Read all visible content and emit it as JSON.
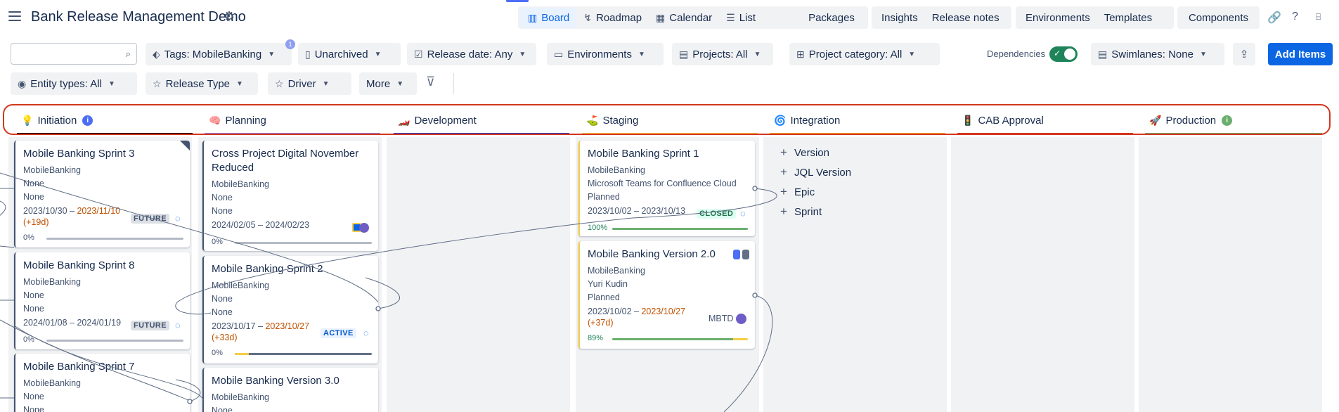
{
  "header": {
    "title": "Bank Release Management Demo",
    "nav_group_1": [
      {
        "label": "Board",
        "icon": "board-icon",
        "active": true
      },
      {
        "label": "Roadmap",
        "icon": "roadmap-icon"
      },
      {
        "label": "Calendar",
        "icon": "calendar-icon"
      },
      {
        "label": "List",
        "icon": "list-icon"
      }
    ],
    "packages": "Packages",
    "nav_group_2": [
      "Insights",
      "Release notes"
    ],
    "nav_group_3": [
      "Environments",
      "Templates"
    ],
    "components": "Components"
  },
  "filters": {
    "search_value": "",
    "tags_count": "1",
    "tags": "Tags: MobileBanking",
    "archived": "Unarchived",
    "release_date": "Release date: Any",
    "environments": "Environments",
    "projects": "Projects: All",
    "project_category": "Project category: All",
    "dependencies_label": "Dependencies",
    "dependencies_on": true,
    "swimlanes": "Swimlanes: None",
    "add_items": "Add Items",
    "entity_types": "Entity types: All",
    "release_type": "Release Type",
    "driver": "Driver",
    "more": "More"
  },
  "columns": [
    {
      "name": "Initiation",
      "emoji": "💡",
      "color": "#000000",
      "info": "i",
      "info_color": "#4c6ef5"
    },
    {
      "name": "Planning",
      "emoji": "🧠",
      "color": "#8f7ee7"
    },
    {
      "name": "Development",
      "emoji": "🏎️",
      "color": "#1d3ed5"
    },
    {
      "name": "Staging",
      "emoji": "⛳",
      "color": "#f5cd47"
    },
    {
      "name": "Integration",
      "emoji": "🌀",
      "color": "#f5a623"
    },
    {
      "name": "CAB Approval",
      "emoji": "🚦",
      "color": "#d3371e"
    },
    {
      "name": "Production",
      "emoji": "🚀",
      "color": "#6aae6e",
      "info": "i",
      "info_color": "#6aae6e"
    }
  ],
  "cards": {
    "c1": {
      "title": "Mobile Banking Sprint 3",
      "project": "MobileBanking",
      "l1": "None",
      "l2": "None",
      "start": "2023/10/30 – ",
      "end": "2023/11/10",
      "delay": "(+19d)",
      "status": "FUTURE",
      "pct": "0%",
      "progress": 0
    },
    "c2": {
      "title": "Mobile Banking Sprint 8",
      "project": "MobileBanking",
      "l1": "None",
      "l2": "None",
      "start": "2024/01/08 – 2024/01/19",
      "status": "FUTURE",
      "pct": "0%",
      "progress": 0
    },
    "c3": {
      "title": "Mobile Banking Sprint 7",
      "project": "MobileBanking",
      "l1": "None",
      "l2": "None"
    },
    "p1": {
      "title": "Cross Project Digital November Reduced",
      "project": "MobileBanking",
      "l1": "None",
      "l2": "None",
      "start": "2024/02/05 – 2024/02/23",
      "pct": "0%",
      "progress": 0
    },
    "p2": {
      "title": "Mobile Banking Sprint 2",
      "project": "MobileBanking",
      "l1": "None",
      "l2": "None",
      "start": "2023/10/17 – ",
      "end": "2023/10/27",
      "delay": "(+33d)",
      "status": "ACTIVE",
      "pct": "0%",
      "progress": 0.1
    },
    "p3": {
      "title": "Mobile Banking Version 3.0",
      "project": "MobileBanking",
      "l1": "None"
    },
    "s1": {
      "title": "Mobile Banking Sprint 1",
      "project": "MobileBanking",
      "l1": "Microsoft Teams for Confluence Cloud",
      "l2": "Planned",
      "start": "2023/10/02 – 2023/10/13",
      "status": "CLOSED",
      "pct": "100%",
      "progress": 1
    },
    "s2": {
      "title": "Mobile Banking Version 2.0",
      "project": "MobileBanking",
      "l1": "Yuri Kudin",
      "l2": "Planned",
      "start": "2023/10/02 – ",
      "end": "2023/10/27",
      "delay": "(+37d)",
      "tag": "MBTD",
      "pct": "89%",
      "progress": 0.89
    }
  },
  "integration_add": [
    "Version",
    "JQL Version",
    "Epic",
    "Sprint"
  ]
}
